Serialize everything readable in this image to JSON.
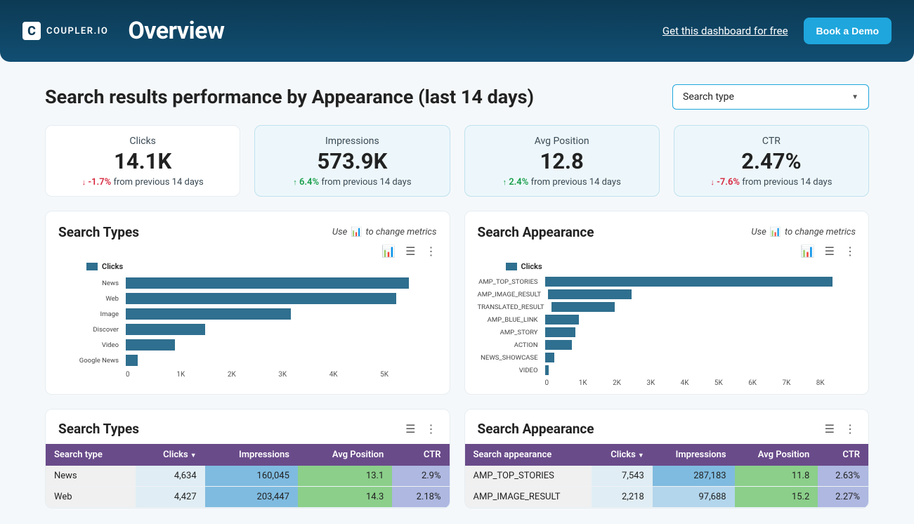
{
  "brand": {
    "mark": "C",
    "name": "COUPLER.IO"
  },
  "header": {
    "title": "Overview",
    "get_link": "Get this dashboard for free",
    "demo_button": "Book a Demo"
  },
  "section": {
    "title": "Search results performance by Appearance (last 14 days)",
    "filter_label": "Search type"
  },
  "kpi": {
    "period_suffix": "from previous 14 days",
    "clicks": {
      "label": "Clicks",
      "value": "14.1K",
      "delta": "-1.7%",
      "dir": "down"
    },
    "impressions": {
      "label": "Impressions",
      "value": "573.9K",
      "delta": "6.4%",
      "dir": "up"
    },
    "position": {
      "label": "Avg Position",
      "value": "12.8",
      "delta": "2.4%",
      "dir": "up"
    },
    "ctr": {
      "label": "CTR",
      "value": "2.47%",
      "delta": "-7.6%",
      "dir": "down"
    }
  },
  "charts_common": {
    "hint_prefix": "Use",
    "hint_suffix": "to change metrics",
    "legend": "Clicks"
  },
  "chart_types": {
    "title": "Search Types",
    "ticks": [
      "0",
      "1K",
      "2K",
      "3K",
      "4K",
      "5K"
    ]
  },
  "chart_appearance": {
    "title": "Search Appearance",
    "ticks": [
      "0",
      "1K",
      "2K",
      "3K",
      "4K",
      "5K",
      "6K",
      "7K",
      "8K"
    ]
  },
  "table_types": {
    "title": "Search Types",
    "headers": {
      "c0": "Search type",
      "c1": "Clicks",
      "c2": "Impressions",
      "c3": "Avg Position",
      "c4": "CTR"
    },
    "rows": [
      {
        "name": "News",
        "clicks": "4,634",
        "impr": "160,045",
        "pos": "13.1",
        "ctr": "2.9%",
        "impr_lt": false
      },
      {
        "name": "Web",
        "clicks": "4,427",
        "impr": "203,447",
        "pos": "14.3",
        "ctr": "2.18%",
        "impr_lt": false
      }
    ]
  },
  "table_appearance": {
    "title": "Search Appearance",
    "headers": {
      "c0": "Search appearance",
      "c1": "Clicks",
      "c2": "Impressions",
      "c3": "Avg Position",
      "c4": "CTR"
    },
    "rows": [
      {
        "name": "AMP_TOP_STORIES",
        "clicks": "7,543",
        "impr": "287,183",
        "pos": "11.8",
        "ctr": "2.63%",
        "impr_lt": false
      },
      {
        "name": "AMP_IMAGE_RESULT",
        "clicks": "2,218",
        "impr": "97,688",
        "pos": "15.2",
        "ctr": "2.27%",
        "impr_lt": true
      }
    ]
  },
  "chart_data": [
    {
      "type": "bar",
      "orientation": "horizontal",
      "title": "Search Types",
      "xlabel": "Clicks",
      "xlim": [
        0,
        5000
      ],
      "categories": [
        "News",
        "Web",
        "Image",
        "Discover",
        "Video",
        "Google News"
      ],
      "values": [
        4634,
        4427,
        2700,
        1300,
        800,
        200
      ],
      "series_name": "Clicks"
    },
    {
      "type": "bar",
      "orientation": "horizontal",
      "title": "Search Appearance",
      "xlabel": "Clicks",
      "xlim": [
        0,
        8000
      ],
      "categories": [
        "AMP_TOP_STORIES",
        "AMP_IMAGE_RESULT",
        "TRANSLATED_RESULT",
        "AMP_BLUE_LINK",
        "AMP_STORY",
        "ACTION",
        "NEWS_SHOWCASE",
        "VIDEO"
      ],
      "values": [
        7543,
        2218,
        1700,
        900,
        800,
        700,
        250,
        100
      ],
      "series_name": "Clicks"
    }
  ]
}
